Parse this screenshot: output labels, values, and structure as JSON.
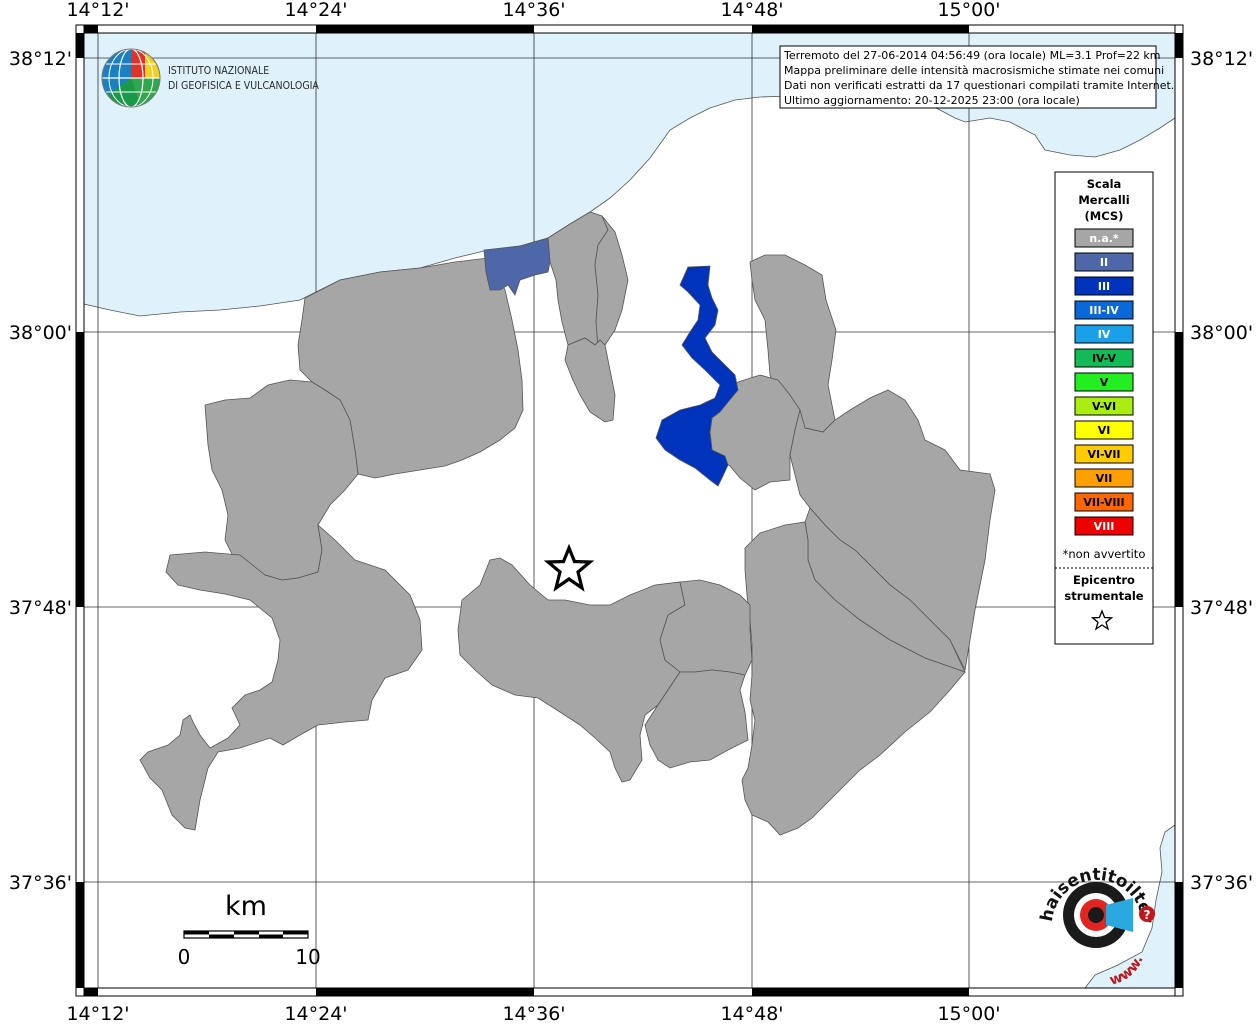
{
  "map": {
    "lon_labels": [
      "14°12'",
      "14°24'",
      "14°36'",
      "14°48'",
      "15°00'"
    ],
    "lat_labels": [
      "38°12'",
      "38°00'",
      "37°48'",
      "37°36'"
    ],
    "colors": {
      "sea": "#dff1fb",
      "land": "#ffffff",
      "no_data": "#a6a6a6",
      "intensity_II": "#4e67a8",
      "intensity_III": "#0033bb",
      "border": "#555555"
    }
  },
  "info_box": {
    "line1": "Terremoto del 27-06-2014 04:56:49 (ora locale) ML=3.1 Prof=22 km",
    "line2": "Mappa preliminare delle intensità macrosismiche stimate nei comuni",
    "line3": "Dati non verificati estratti da 17 questionari compilati tramite Internet.",
    "line4": "Ultimo aggiornamento: 20-12-2025 23:00 (ora locale)"
  },
  "logo_ingv": {
    "line1": "ISTITUTO NAZIONALE",
    "line2": "DI GEOFISICA E VULCANOLOGIA"
  },
  "legend": {
    "title1": "Scala",
    "title2": "Mercalli",
    "title3": "(MCS)",
    "items": [
      {
        "label": "n.a.*",
        "color": "#a6a6a6",
        "text": "#ffffff"
      },
      {
        "label": "II",
        "color": "#4e67a8",
        "text": "#ffffff"
      },
      {
        "label": "III",
        "color": "#0033bb",
        "text": "#ffffff"
      },
      {
        "label": "III-IV",
        "color": "#0a68d8",
        "text": "#ffffff"
      },
      {
        "label": "IV",
        "color": "#1aa0e8",
        "text": "#ffffff"
      },
      {
        "label": "IV-V",
        "color": "#11bb55",
        "text": "#000000"
      },
      {
        "label": "V",
        "color": "#22ee22",
        "text": "#000000"
      },
      {
        "label": "V-VI",
        "color": "#aaee11",
        "text": "#000000"
      },
      {
        "label": "VI",
        "color": "#ffff00",
        "text": "#000000"
      },
      {
        "label": "VI-VII",
        "color": "#ffcc00",
        "text": "#000000"
      },
      {
        "label": "VII",
        "color": "#ffa000",
        "text": "#000000"
      },
      {
        "label": "VII-VIII",
        "color": "#ff6600",
        "text": "#000000"
      },
      {
        "label": "VIII",
        "color": "#ee0000",
        "text": "#ffffff"
      }
    ],
    "note": "*non avvertito",
    "epicenter1": "Epicentro",
    "epicenter2": "strumentale"
  },
  "scale_bar": {
    "unit": "km",
    "start": "0",
    "end": "10"
  },
  "logo_hsit": {
    "text": "haisentitoilterremoto.it",
    "prefix": "www."
  }
}
